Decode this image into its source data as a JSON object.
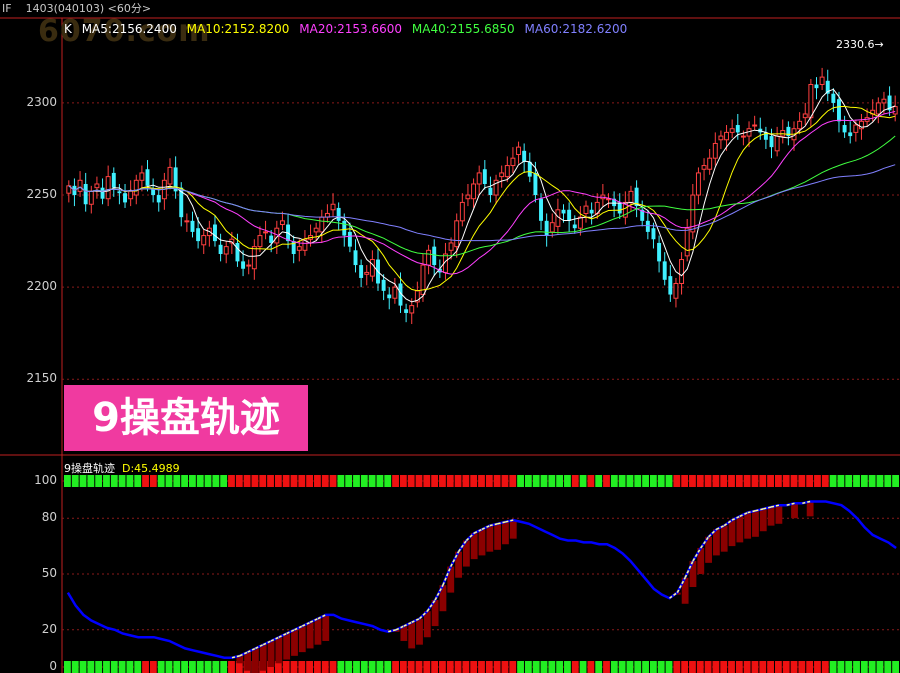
{
  "header": {
    "symbol": "IF",
    "contract": "1403(040103)",
    "period": "<60分>",
    "watermark": "6070.com"
  },
  "ma_legend": {
    "k_label": "K",
    "items": [
      {
        "label": "MA5:2156.2400",
        "color": "#ffffff"
      },
      {
        "label": "MA10:2152.8200",
        "color": "#ffff00"
      },
      {
        "label": "MA20:2153.6600",
        "color": "#ff40ff"
      },
      {
        "label": "MA40:2155.6850",
        "color": "#40ff40"
      },
      {
        "label": "MA60:2182.6200",
        "color": "#8080ff"
      }
    ]
  },
  "max_label": "2330.6",
  "overlay_label": "9操盘轨迹",
  "indicator": {
    "name": "9操盘轨迹",
    "value_label": "D:45.4989"
  },
  "colors": {
    "up": "#ff4040",
    "down": "#40f0ff",
    "grid": "#8a1a1a",
    "axis": "#c02020",
    "ribbon_green": "#22ee22",
    "ribbon_red": "#ee1111",
    "hist_red": "#8b0000",
    "line_blue": "#0000ff",
    "line_yellow": "#ffff88"
  },
  "chart_data": [
    {
      "type": "candlestick",
      "title": "",
      "ylim": [
        2110,
        2345
      ],
      "yticks": [
        2150,
        2200,
        2250,
        2300
      ],
      "max_marker": 2330.6,
      "close": [
        2255,
        2250,
        2258,
        2245,
        2252,
        2256,
        2248,
        2260,
        2254,
        2251,
        2246,
        2252,
        2258,
        2262,
        2255,
        2250,
        2246,
        2258,
        2265,
        2252,
        2238,
        2236,
        2230,
        2225,
        2228,
        2232,
        2225,
        2218,
        2222,
        2226,
        2214,
        2210,
        2212,
        2222,
        2228,
        2230,
        2224,
        2232,
        2236,
        2225,
        2218,
        2222,
        2226,
        2228,
        2232,
        2238,
        2240,
        2245,
        2236,
        2228,
        2222,
        2212,
        2205,
        2208,
        2215,
        2202,
        2198,
        2194,
        2200,
        2190,
        2186,
        2190,
        2198,
        2212,
        2220,
        2212,
        2208,
        2218,
        2224,
        2236,
        2246,
        2250,
        2256,
        2262,
        2256,
        2250,
        2258,
        2262,
        2266,
        2270,
        2276,
        2268,
        2260,
        2250,
        2236,
        2228,
        2235,
        2242,
        2240,
        2236,
        2232,
        2238,
        2244,
        2240,
        2246,
        2250,
        2248,
        2244,
        2240,
        2246,
        2252,
        2244,
        2236,
        2230,
        2226,
        2214,
        2204,
        2196,
        2202,
        2215,
        2232,
        2250,
        2262,
        2266,
        2270,
        2278,
        2282,
        2284,
        2286,
        2284,
        2282,
        2286,
        2288,
        2284,
        2280,
        2276,
        2282,
        2285,
        2282,
        2286,
        2290,
        2294,
        2310,
        2308,
        2314,
        2305,
        2300,
        2290,
        2284,
        2282,
        2288,
        2290,
        2292,
        2296,
        2300,
        2302,
        2296,
        2298
      ],
      "ma5_last": 2156.24,
      "ma10_last": 2152.82,
      "ma20_last": 2153.66,
      "ma40_last": 2155.685,
      "ma60_last": 2182.62
    },
    {
      "type": "line",
      "title": "",
      "ylim": [
        -5,
        105
      ],
      "yticks": [
        0,
        20,
        50,
        80,
        100
      ],
      "series": [
        {
          "name": "D",
          "last": 45.4989
        }
      ],
      "d": [
        40,
        33,
        28,
        25,
        23,
        21,
        20,
        18,
        17,
        16,
        16,
        16,
        15,
        14,
        12,
        10,
        9,
        8,
        7,
        6,
        5,
        5,
        6,
        8,
        10,
        12,
        14,
        16,
        18,
        20,
        22,
        24,
        26,
        28,
        28,
        26,
        25,
        24,
        23,
        22,
        20,
        19,
        20,
        22,
        24,
        26,
        30,
        36,
        44,
        54,
        62,
        68,
        72,
        74,
        76,
        77,
        78,
        79,
        78,
        77,
        75,
        73,
        71,
        69,
        68,
        68,
        67,
        67,
        66,
        66,
        64,
        61,
        57,
        52,
        47,
        42,
        39,
        37,
        40,
        48,
        57,
        64,
        70,
        74,
        76,
        79,
        81,
        83,
        84,
        85,
        86,
        87,
        87,
        88,
        88,
        89,
        89,
        89,
        88,
        87,
        84,
        80,
        75,
        71,
        69,
        67,
        64
      ]
    }
  ]
}
